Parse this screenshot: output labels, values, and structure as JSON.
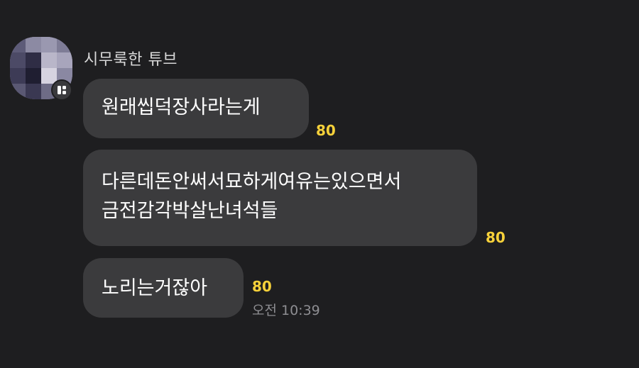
{
  "chat": {
    "sender": {
      "name": "시무룩한 튜브",
      "avatar_icon": "pixelated-avatar-image",
      "badge_icon": "multi-profile-icon"
    },
    "messages": [
      {
        "lines": [
          "원래씹덕장사라는게"
        ],
        "unread_count": "80"
      },
      {
        "lines": [
          "다른데돈안써서묘하게여유는있으면서",
          "금전감각박살난녀석들"
        ],
        "unread_count": "80"
      },
      {
        "lines": [
          "노리는거잖아"
        ],
        "unread_count": "80",
        "time": "오전 10:39"
      }
    ]
  },
  "colors": {
    "background": "#1e1e20",
    "bubble": "#3b3b3d",
    "unread": "#f7d13a",
    "timestamp": "#8e8e92"
  }
}
